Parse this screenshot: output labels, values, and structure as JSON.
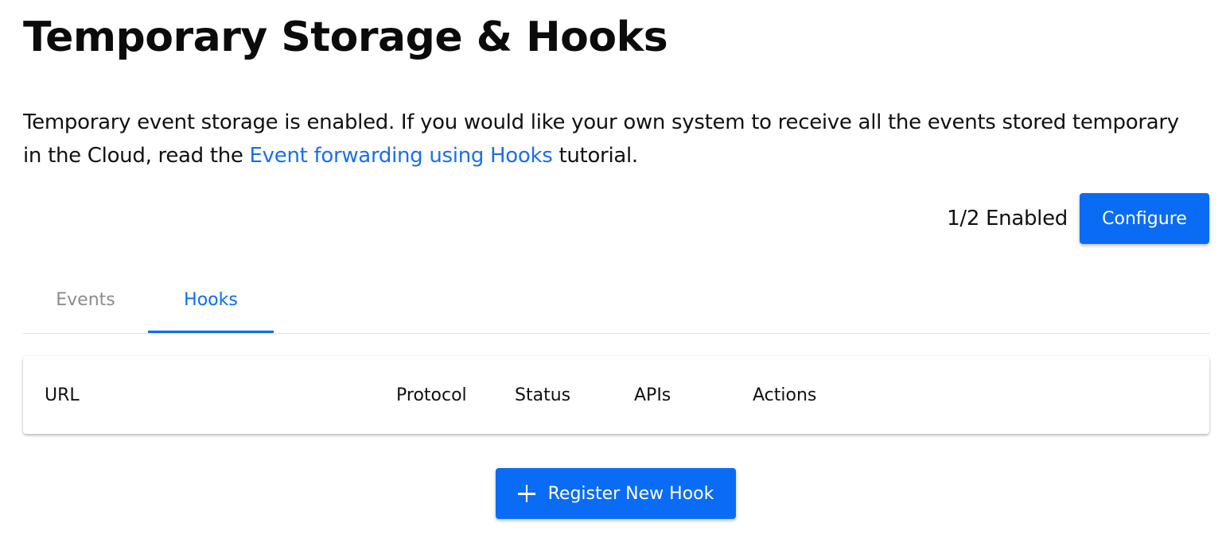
{
  "page": {
    "title": "Temporary Storage & Hooks"
  },
  "intro": {
    "text_before": "Temporary event storage is enabled. If you would like your own system to receive all the events stored temporary in the Cloud, read the ",
    "link_text": "Event forwarding using Hooks",
    "text_after": " tutorial."
  },
  "status": {
    "enabled_count": "1/2 Enabled",
    "configure_label": "Configure"
  },
  "tabs": [
    {
      "label": "Events",
      "active": false
    },
    {
      "label": "Hooks",
      "active": true
    }
  ],
  "table": {
    "columns": [
      "URL",
      "Protocol",
      "Status",
      "APIs",
      "Actions"
    ],
    "rows": []
  },
  "actions": {
    "register_label": "Register New Hook",
    "register_icon": "plus-icon"
  },
  "colors": {
    "accent": "#0a6cf5",
    "link": "#1a6ef0",
    "inactive_tab": "#8c8c8c"
  }
}
